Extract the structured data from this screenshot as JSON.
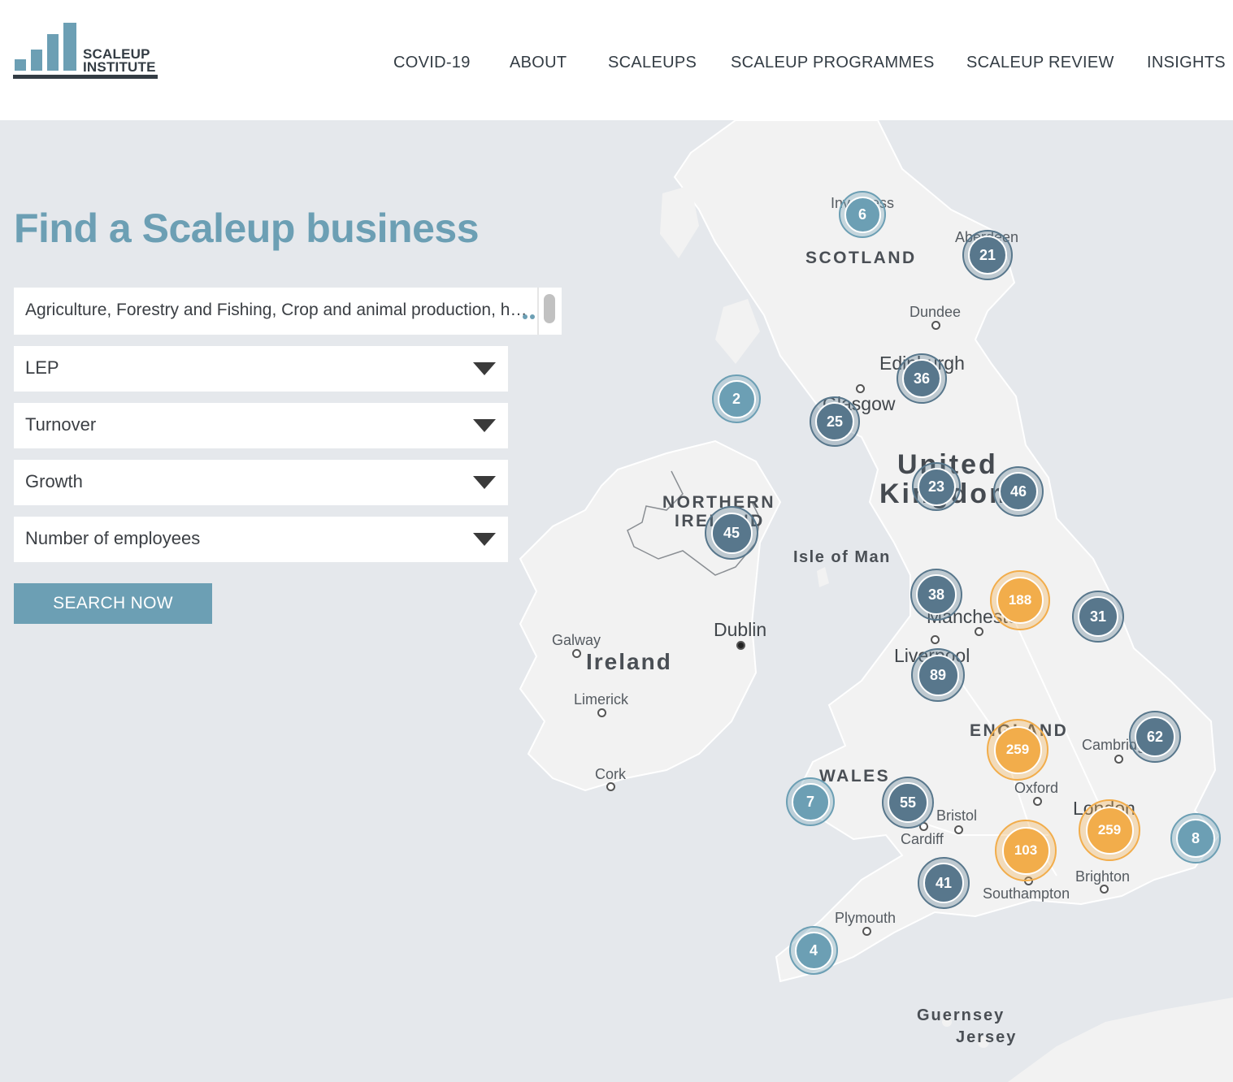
{
  "brand": {
    "line1": "SCALEUP",
    "line2": "INSTITUTE"
  },
  "nav": [
    "COVID-19",
    "ABOUT",
    "SCALEUPS",
    "SCALEUP PROGRAMMES",
    "SCALEUP REVIEW",
    "INSIGHTS"
  ],
  "page": {
    "title": "Find a Scaleup business"
  },
  "filters": {
    "sector": "Agriculture, Forestry and Fishing, Crop and animal production, hunting and related service activities",
    "lep": "LEP",
    "turnover": "Turnover",
    "growth": "Growth",
    "employees": "Number of employees"
  },
  "search_button": "SEARCH NOW",
  "map": {
    "labels": {
      "inverness": "Inverness",
      "aberdeen": "Aberdeen",
      "scotland": "SCOTLAND",
      "dundee": "Dundee",
      "edinburgh": "Edinburgh",
      "glasgow": "Glasgow",
      "united": "United",
      "kingdom": "Kingdom",
      "northern_ireland_1": "NORTHERN",
      "northern_ireland_2": "IRELAND",
      "isle_of_man": "Isle of Man",
      "dublin": "Dublin",
      "galway": "Galway",
      "ireland": "Ireland",
      "limerick": "Limerick",
      "cork": "Cork",
      "manchester": "Manchester",
      "liverpool": "Liverpool",
      "england": "ENGLAND",
      "cambridge": "Cambridge",
      "wales": "WALES",
      "oxford": "Oxford",
      "bristol": "Bristol",
      "cardiff": "Cardiff",
      "london": "London",
      "brighton": "Brighton",
      "southampton": "Southampton",
      "plymouth": "Plymouth",
      "guernsey": "Guernsey",
      "jersey": "Jersey"
    },
    "clusters": [
      {
        "id": "inverness",
        "count": "6",
        "tier": "small"
      },
      {
        "id": "aberdeen",
        "count": "21",
        "tier": "medium"
      },
      {
        "id": "northwest-isles",
        "count": "2",
        "tier": "small"
      },
      {
        "id": "edinburgh",
        "count": "36",
        "tier": "medium"
      },
      {
        "id": "glasgow",
        "count": "25",
        "tier": "medium"
      },
      {
        "id": "borders",
        "count": "23",
        "tier": "medium"
      },
      {
        "id": "north-east",
        "count": "46",
        "tier": "medium"
      },
      {
        "id": "belfast",
        "count": "45",
        "tier": "medium"
      },
      {
        "id": "lancashire",
        "count": "38",
        "tier": "medium"
      },
      {
        "id": "yorkshire",
        "count": "188",
        "tier": "large"
      },
      {
        "id": "east-yorkshire",
        "count": "31",
        "tier": "medium"
      },
      {
        "id": "liverpool",
        "count": "89",
        "tier": "medium"
      },
      {
        "id": "midlands",
        "count": "259",
        "tier": "large"
      },
      {
        "id": "east-anglia",
        "count": "62",
        "tier": "medium"
      },
      {
        "id": "west-wales",
        "count": "7",
        "tier": "small"
      },
      {
        "id": "south-wales",
        "count": "55",
        "tier": "medium"
      },
      {
        "id": "london",
        "count": "259",
        "tier": "large"
      },
      {
        "id": "kent",
        "count": "8",
        "tier": "small"
      },
      {
        "id": "southampton",
        "count": "103",
        "tier": "large"
      },
      {
        "id": "devon",
        "count": "41",
        "tier": "medium"
      },
      {
        "id": "cornwall",
        "count": "4",
        "tier": "small"
      }
    ],
    "colors": {
      "small": "#6c9fb4",
      "medium": "#58778c",
      "large": "#f2ad4b"
    }
  }
}
